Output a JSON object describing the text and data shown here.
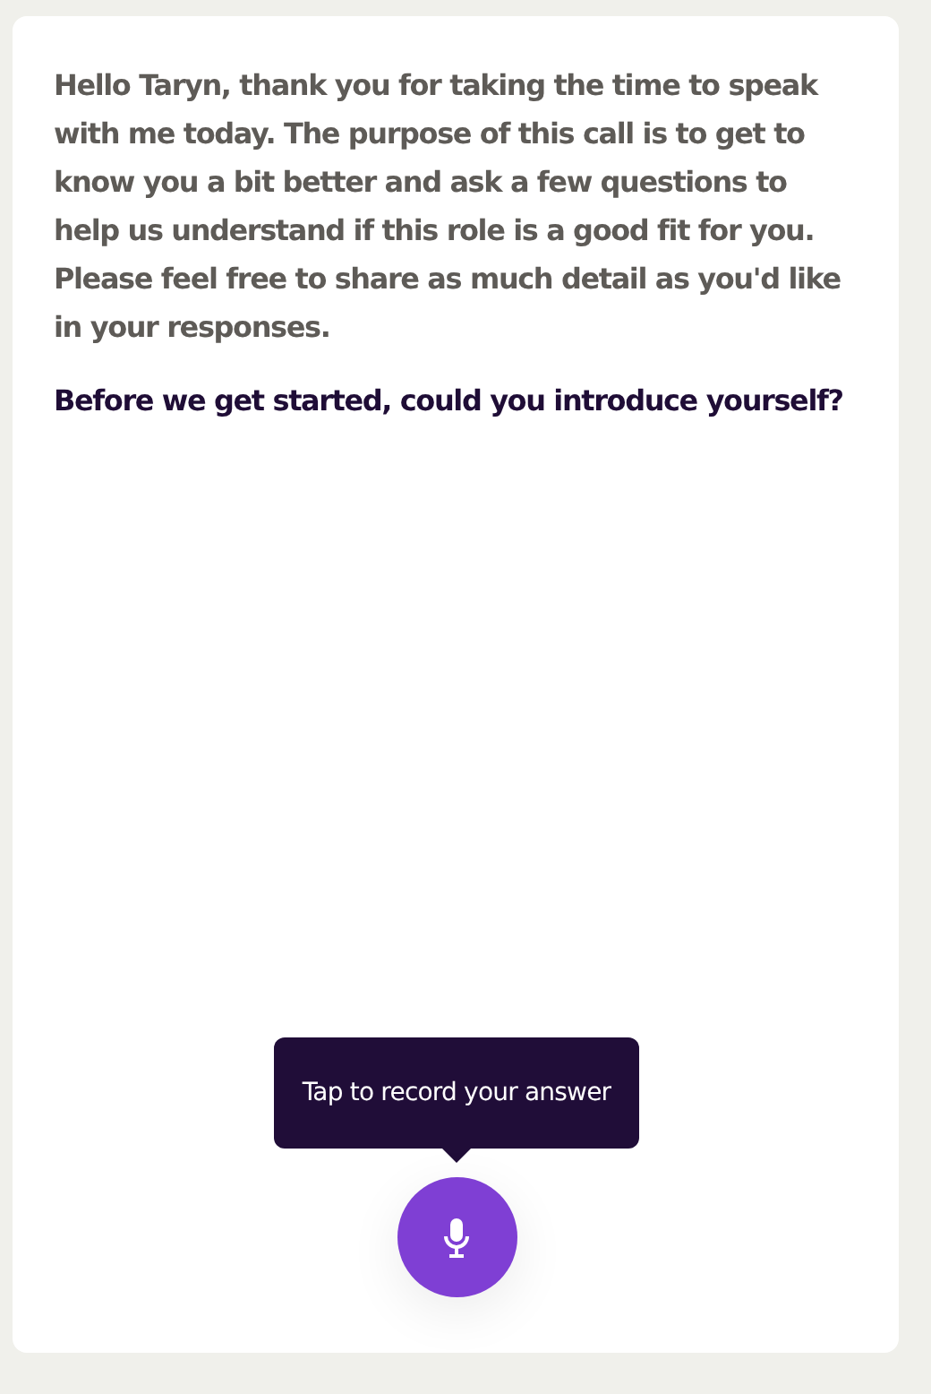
{
  "messages": [
    {
      "kind": "intro",
      "text": "Hello Taryn, thank you for taking the time to speak with me today. The purpose of this call is to get to know you a bit better and ask a few questions to help us understand if this role is a good fit for you. Please feel free to share as much detail as you'd like in your responses."
    },
    {
      "kind": "question",
      "text": "Before we get started, could you introduce yourself?"
    }
  ],
  "tooltip": "Tap to record your answer"
}
